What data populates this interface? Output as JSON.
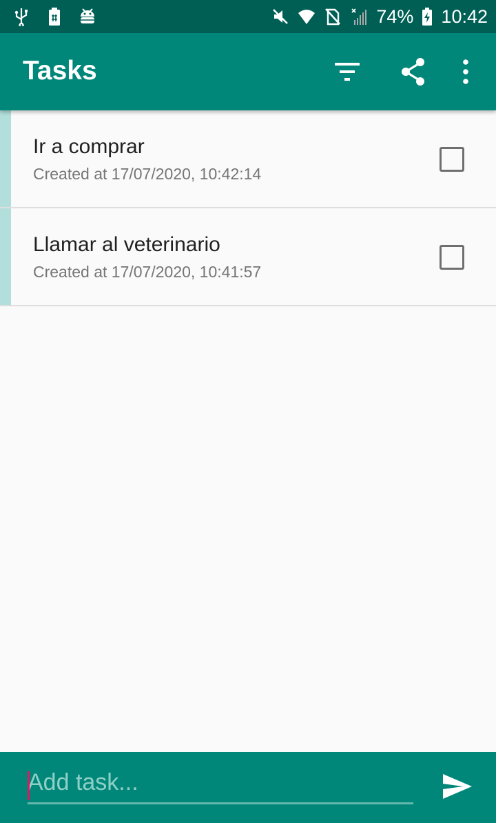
{
  "status_bar": {
    "battery_percent": "74%",
    "time": "10:42",
    "icons_left": [
      "usb-icon",
      "battery-saver-icon",
      "android-debug-icon"
    ],
    "icons_right": [
      "mute-icon",
      "wifi-icon",
      "no-sim-icon",
      "signal-icon",
      "battery-charging-icon"
    ]
  },
  "app_bar": {
    "title": "Tasks",
    "actions": [
      "filter-icon",
      "share-icon",
      "more-vert-icon"
    ]
  },
  "tasks": [
    {
      "title": "Ir a comprar",
      "subtitle": "Created at 17/07/2020, 10:42:14",
      "checked": false
    },
    {
      "title": "Llamar al veterinario",
      "subtitle": "Created at 17/07/2020, 10:41:57",
      "checked": false
    }
  ],
  "input": {
    "placeholder": "Add task...",
    "value": ""
  },
  "colors": {
    "status_bar": "#005f55",
    "primary": "#00877a",
    "accent": "#d81b60",
    "task_accent": "#b2dfdb"
  }
}
